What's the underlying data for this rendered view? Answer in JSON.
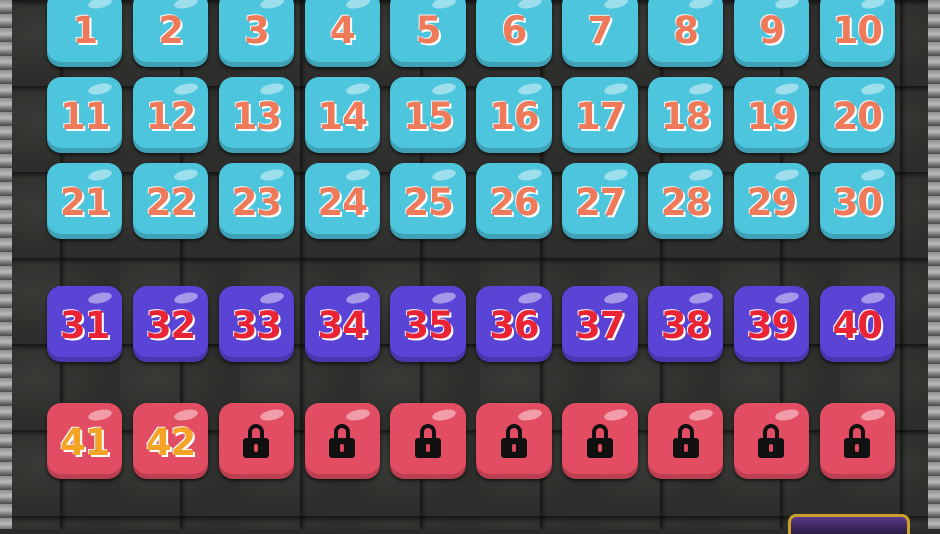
{
  "levels": {
    "row1": [
      "1",
      "2",
      "3",
      "4",
      "5",
      "6",
      "7",
      "8",
      "9",
      "10"
    ],
    "row2": [
      "11",
      "12",
      "13",
      "14",
      "15",
      "16",
      "17",
      "18",
      "19",
      "20"
    ],
    "row3": [
      "21",
      "22",
      "23",
      "24",
      "25",
      "26",
      "27",
      "28",
      "29",
      "30"
    ],
    "row4": [
      "31",
      "32",
      "33",
      "34",
      "35",
      "36",
      "37",
      "38",
      "39",
      "40"
    ],
    "row5": [
      "41",
      "42"
    ]
  },
  "row5_locked_count": 8,
  "colors": {
    "row_cyan": "#4dc5dd",
    "row_purple": "#5a44d6",
    "row_red": "#e34d63",
    "num_orange": "#ef7a5a",
    "num_red": "#ea2434",
    "num_gold": "#f5a324"
  },
  "icons": {
    "locked": "lock-icon"
  }
}
